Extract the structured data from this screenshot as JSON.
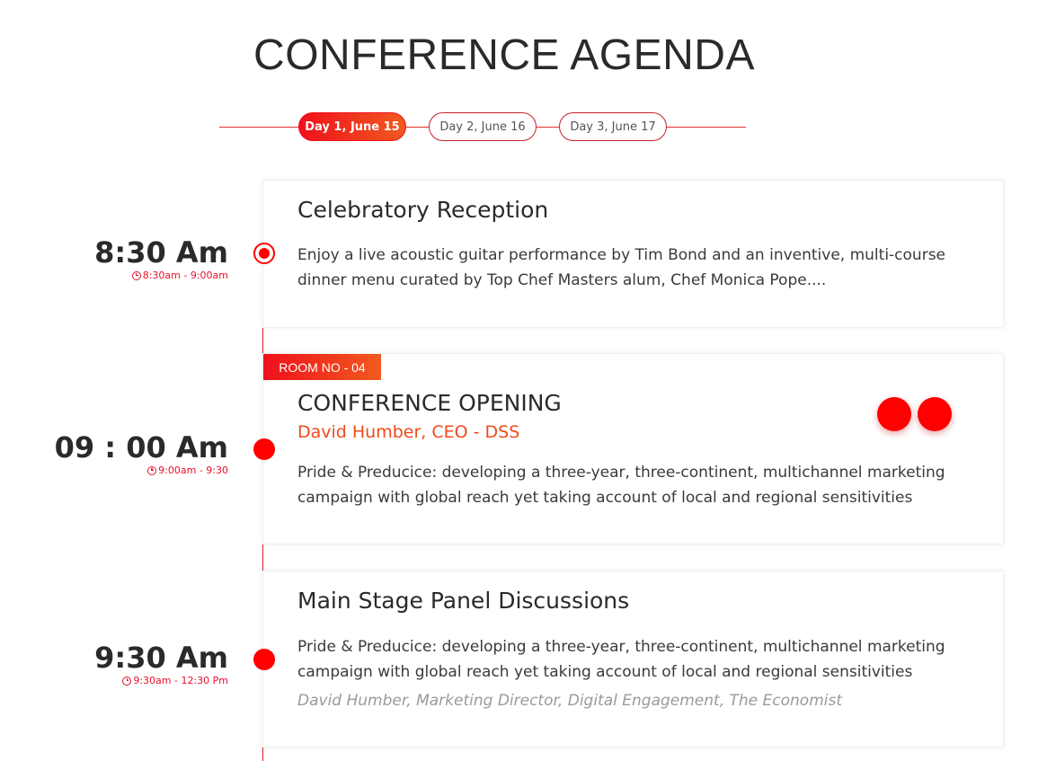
{
  "header": {
    "title": "CONFERENCE AGENDA"
  },
  "tabs": [
    {
      "label": "Day 1, June 15",
      "active": true
    },
    {
      "label": "Day 2, June 16",
      "active": false
    },
    {
      "label": "Day 3, June 17",
      "active": false
    }
  ],
  "sessions": [
    {
      "time": "8:30 Am",
      "range": "8:30am - 9:00am",
      "title": "Celebratory Reception",
      "description": "Enjoy a live acoustic guitar performance by Tim Bond and an inventive, multi-course dinner menu curated by Top Chef Masters alum, Chef Monica Pope...."
    },
    {
      "time": "09 : 00 Am",
      "range": "9:00am - 9:30",
      "room": "ROOM NO - 04",
      "title": "CONFERENCE OPENING",
      "speaker": "David Humber, CEO - DSS",
      "description": "Pride & Preducice: developing a three-year, three-continent, multichannel marketing campaign with global reach yet taking account of local and regional sensitivities"
    },
    {
      "time": "9:30 Am",
      "range": "9:30am - 12:30 Pm",
      "title": "Main Stage Panel Discussions",
      "description": "Pride & Preducice: developing a three-year, three-continent, multichannel marketing campaign with global reach yet taking account of local and regional sensitivities",
      "credit": "David Humber, Marketing Director, Digital Engagement, The Economist"
    }
  ],
  "colors": {
    "accent": "#f0101c",
    "accent_end": "#f15a1e",
    "speaker": "#f04a1c"
  },
  "icons": {
    "clock": "clock-icon"
  }
}
